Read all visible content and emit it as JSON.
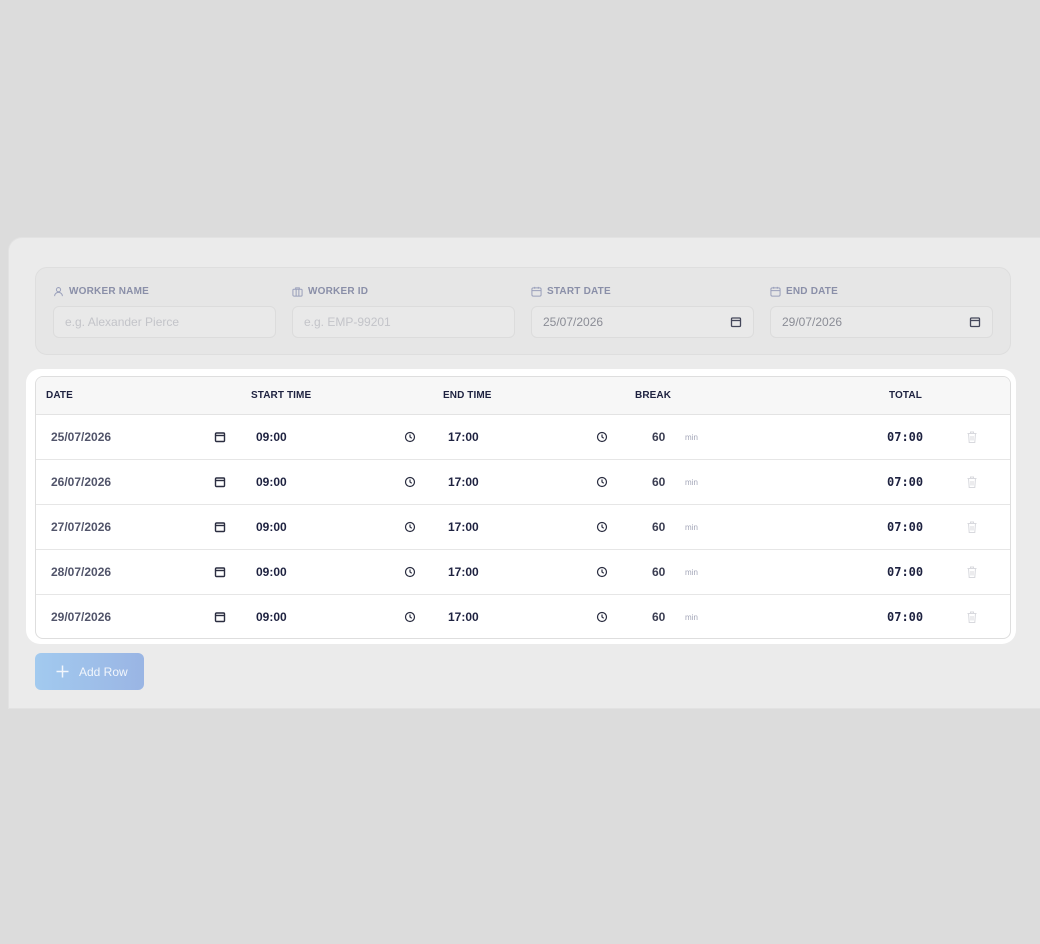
{
  "header": {
    "worker_name": {
      "label": "WORKER NAME",
      "placeholder": "e.g. Alexander Pierce",
      "icon": "user-icon"
    },
    "worker_id": {
      "label": "WORKER ID",
      "placeholder": "e.g. EMP-99201",
      "icon": "briefcase-icon"
    },
    "start_date": {
      "label": "START DATE",
      "value": "25/07/2026",
      "icon": "calendar-icon"
    },
    "end_date": {
      "label": "END DATE",
      "value": "29/07/2026",
      "icon": "calendar-icon"
    }
  },
  "table": {
    "columns": [
      "DATE",
      "START TIME",
      "END TIME",
      "BREAK",
      "TOTAL"
    ],
    "break_unit": "min",
    "rows": [
      {
        "date": "25/07/2026",
        "start": "09:00",
        "end": "17:00",
        "break": "60",
        "total": "07:00"
      },
      {
        "date": "26/07/2026",
        "start": "09:00",
        "end": "17:00",
        "break": "60",
        "total": "07:00"
      },
      {
        "date": "27/07/2026",
        "start": "09:00",
        "end": "17:00",
        "break": "60",
        "total": "07:00"
      },
      {
        "date": "28/07/2026",
        "start": "09:00",
        "end": "17:00",
        "break": "60",
        "total": "07:00"
      },
      {
        "date": "29/07/2026",
        "start": "09:00",
        "end": "17:00",
        "break": "60",
        "total": "07:00"
      }
    ]
  },
  "actions": {
    "add_row_label": "Add Row"
  },
  "colors": {
    "accent": "#9ec0ea",
    "text_dark": "#1e2240",
    "label_muted": "#8a8fa8"
  }
}
